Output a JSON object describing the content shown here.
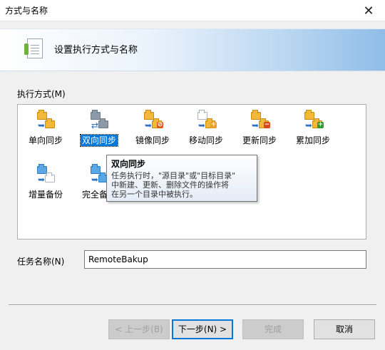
{
  "window": {
    "title": "方式与名称",
    "close_glyph": "✕"
  },
  "banner": {
    "heading": "设置执行方式与名称",
    "icon": "document-icon"
  },
  "modes": {
    "group_label": "执行方式(M)",
    "items": [
      {
        "label": "单向同步",
        "icon": "one-way-sync-icon"
      },
      {
        "label": "双向同步",
        "icon": "two-way-sync-icon",
        "selected": true
      },
      {
        "label": "镜像同步",
        "icon": "mirror-sync-icon"
      },
      {
        "label": "移动同步",
        "icon": "move-sync-icon"
      },
      {
        "label": "更新同步",
        "icon": "update-sync-icon"
      },
      {
        "label": "累加同步",
        "icon": "cumulative-sync-icon"
      },
      {
        "label": "增量备份",
        "icon": "incremental-backup-icon"
      },
      {
        "label": "完全备份",
        "icon": "full-backup-icon"
      }
    ]
  },
  "tooltip": {
    "title": "双向同步",
    "line1": "任务执行时，\"源目录\"或\"目标目录\"",
    "line2": "中新建、更新、删除文件的操作将",
    "line3": "在另一个目录中被执行。"
  },
  "task_name": {
    "label": "任务名称(N)",
    "value": "RemoteBakup"
  },
  "buttons": {
    "back": "< 上一步(B)",
    "next": "下一步(N) >",
    "finish": "完成",
    "cancel": "取消"
  },
  "colors": {
    "selection": "#0078d7",
    "banner_end": "#8fbde8"
  }
}
